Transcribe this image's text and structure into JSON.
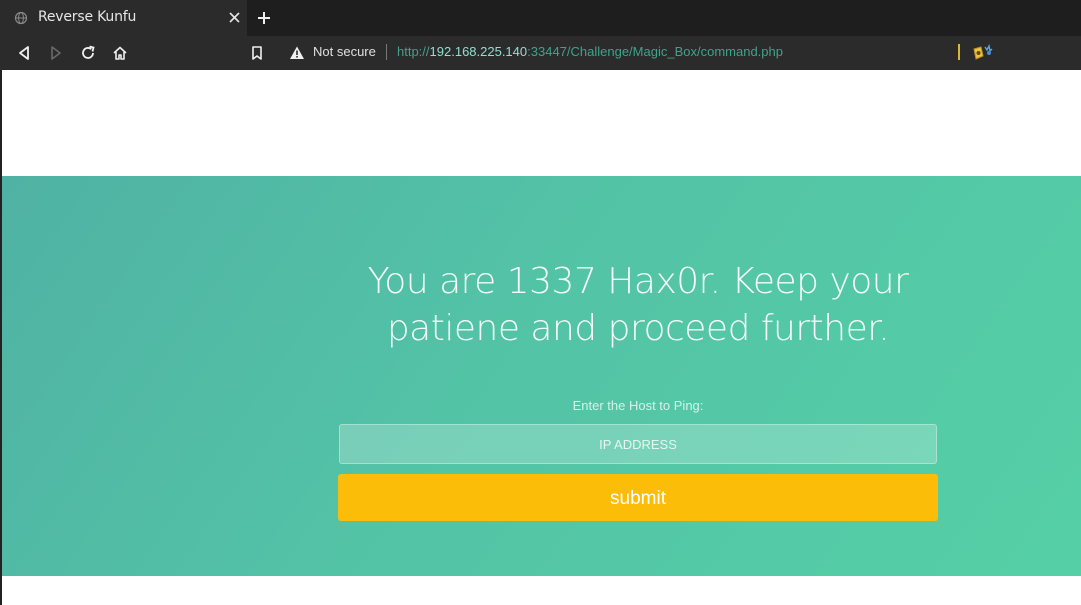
{
  "browser": {
    "tab_title": "Reverse Kunfu",
    "new_tab_icon": "plus-icon",
    "url_scheme": "http://",
    "url_host": "192.168.225.140",
    "url_rest": ":33447/Challenge/Magic_Box/command.php",
    "security_label": "Not secure",
    "accent_color": "#3fa38a"
  },
  "page": {
    "heading": "You are 1337 Hax0r. Keep your patiene and proceed further.",
    "ping_label": "Enter the Host to Ping:",
    "ip_placeholder": "IP ADDRESS",
    "submit_label": "submit",
    "hero_color": "#53c3a6",
    "button_color": "#fbbd08"
  }
}
